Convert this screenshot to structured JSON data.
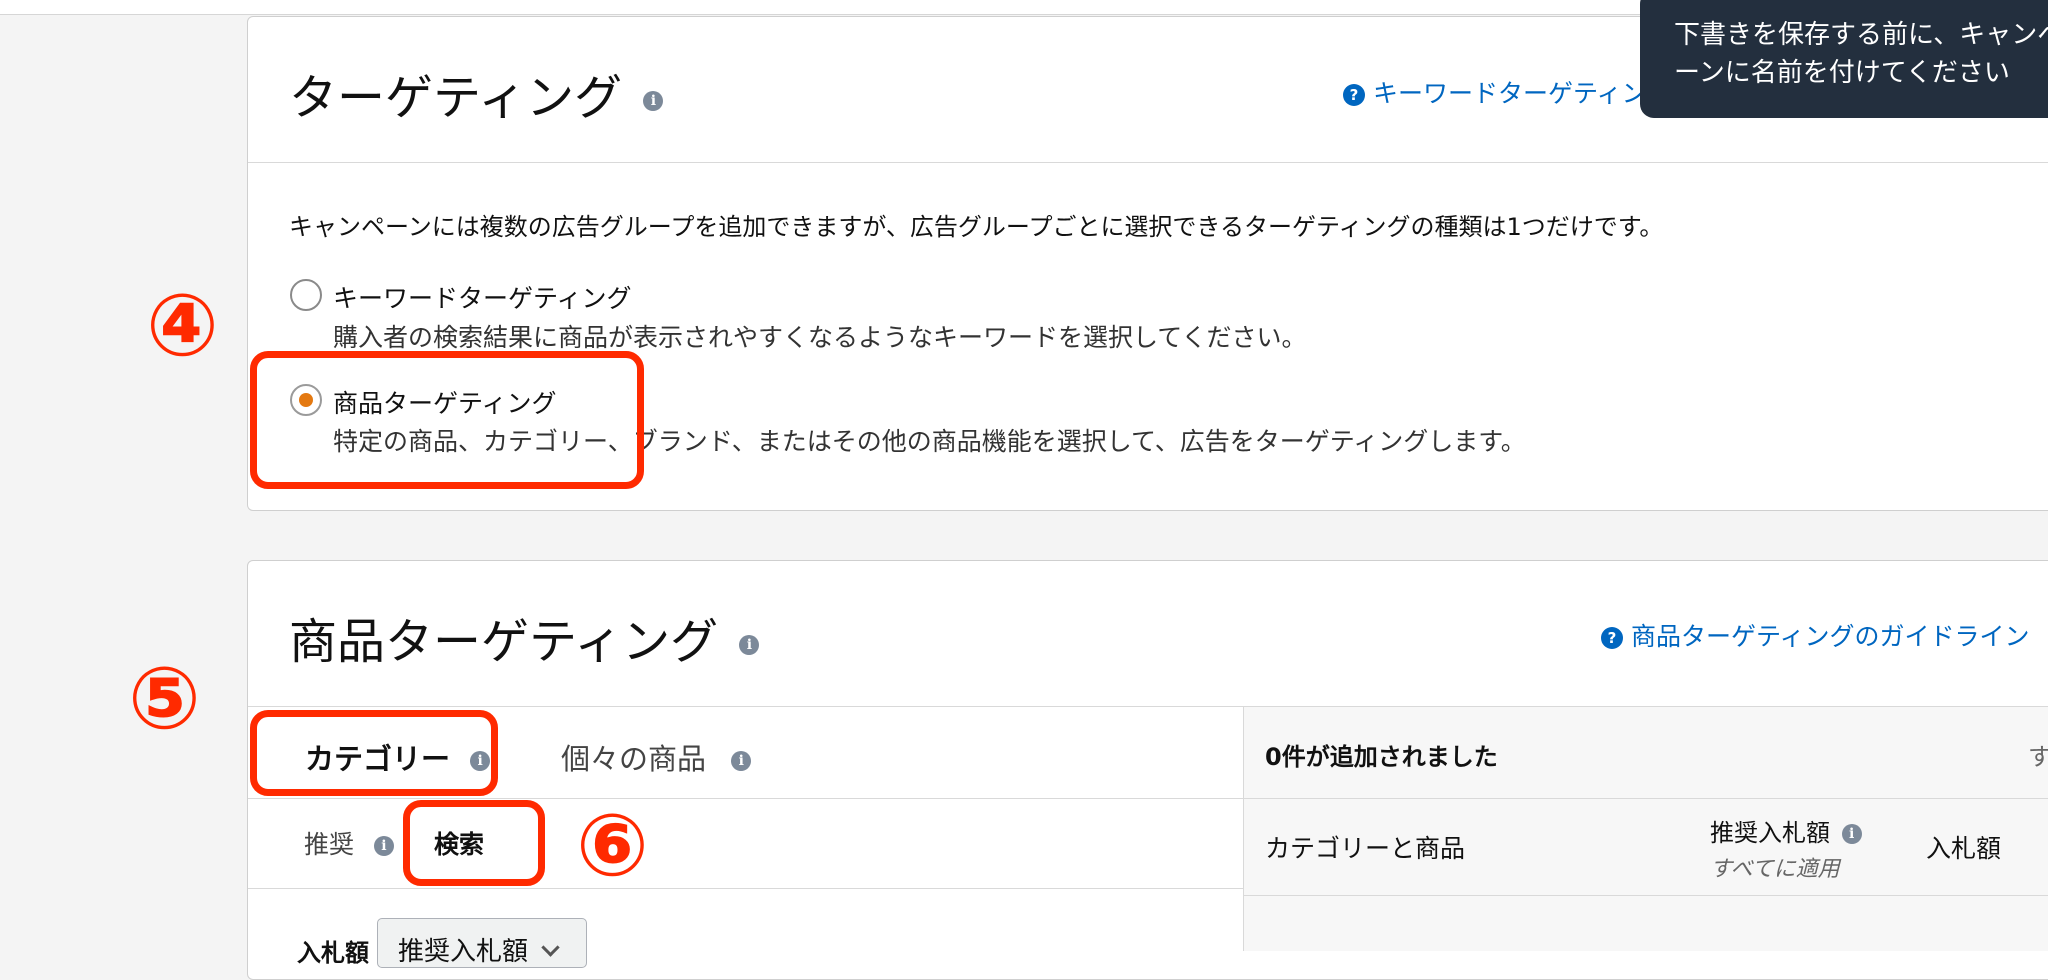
{
  "toast": {
    "message": "下書きを保存する前に、キャンペーンに名前を付けてください"
  },
  "targeting": {
    "title": "ターゲティング",
    "help_link": "キーワードターゲティングとは",
    "description": "キャンペーンには複数の広告グループを追加できますが、広告グループごとに選択できるターゲティングの種類は1つだけです。",
    "options": [
      {
        "label": "キーワードターゲティング",
        "description": "購入者の検索結果に商品が表示されやすくなるようなキーワードを選択してください。",
        "selected": false
      },
      {
        "label": "商品ターゲティング",
        "description": "特定の商品、カテゴリー、ブランド、またはその他の商品機能を選択して、広告をターゲティングします。",
        "selected": true
      }
    ]
  },
  "product_targeting": {
    "title": "商品ターゲティング",
    "guide_link": "商品ターゲティングのガイドライン",
    "tabs": [
      {
        "label": "カテゴリー",
        "active": true
      },
      {
        "label": "個々の商品",
        "active": false
      }
    ],
    "subtabs": [
      {
        "label": "推奨",
        "active": false
      },
      {
        "label": "検索",
        "active": true
      }
    ],
    "bid_label": "入札額",
    "bid_select_value": "推奨入札額",
    "right_panel": {
      "added_count": "0件が追加されました",
      "truncated_action": "す",
      "columns": {
        "category": "カテゴリーと商品",
        "suggested_bid": "推奨入札額",
        "apply_all": "すべてに適用",
        "bid": "入札額"
      }
    }
  },
  "annotations": {
    "step4": "④",
    "step5": "⑤",
    "step6": "⑥"
  },
  "colors": {
    "accent_red": "#ff2a00",
    "radio_selected": "#e47911",
    "link": "#0066c0",
    "toast_bg": "#232f3e"
  }
}
